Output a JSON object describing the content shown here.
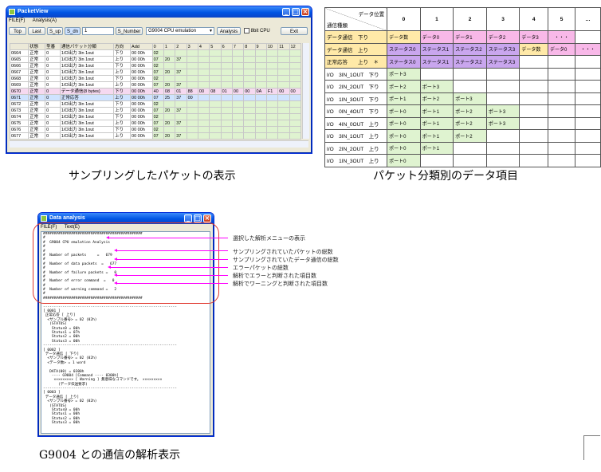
{
  "packetview": {
    "title": "PacketView",
    "menu": [
      "FILE(F)",
      "Analysis(A)"
    ],
    "toolbar": {
      "top": "Top",
      "last": "Last",
      "s_up": "S_up",
      "s_dn": "S_dn",
      "number_value": "1",
      "s_number": "S_Number",
      "emulation": "G9004 CPU emulation",
      "analysis": "Analysis",
      "bit_cpu": "8bit CPU",
      "exit": "Exit"
    },
    "columns": [
      "",
      "状態",
      "型番",
      "通信パケット分類",
      "方向",
      "Add",
      "0",
      "1",
      "2",
      "3",
      "4",
      "5",
      "6",
      "7",
      "8",
      "9",
      "10",
      "11",
      "12"
    ],
    "rows": [
      [
        "0664",
        "正常",
        "0",
        "1/O出力 3in 1out",
        "下り",
        "00 00h",
        "02",
        "",
        "",
        "",
        "",
        "",
        "",
        "",
        "",
        "",
        "",
        "",
        ""
      ],
      [
        "0665",
        "正常",
        "0",
        "1/O出力 3in 1out",
        "上り",
        "00 00h",
        "07",
        "20",
        "37",
        "",
        "",
        "",
        "",
        "",
        "",
        "",
        "",
        "",
        ""
      ],
      [
        "0666",
        "正常",
        "0",
        "1/O出力 3in 1out",
        "下り",
        "00 00h",
        "02",
        "",
        "",
        "",
        "",
        "",
        "",
        "",
        "",
        "",
        "",
        "",
        ""
      ],
      [
        "0667",
        "正常",
        "0",
        "1/O出力 3in 1out",
        "上り",
        "00 00h",
        "07",
        "20",
        "37",
        "",
        "",
        "",
        "",
        "",
        "",
        "",
        "",
        "",
        ""
      ],
      [
        "0668",
        "正常",
        "0",
        "1/O出力 3in 1out",
        "下り",
        "00 00h",
        "02",
        "",
        "",
        "",
        "",
        "",
        "",
        "",
        "",
        "",
        "",
        "",
        ""
      ],
      [
        "0669",
        "正常",
        "0",
        "1/O出力 3in 1out",
        "上り",
        "00 00h",
        "07",
        "20",
        "37",
        "",
        "",
        "",
        "",
        "",
        "",
        "",
        "",
        "",
        ""
      ],
      [
        "0670",
        "正常",
        "0",
        "データ通信(8 bytes)",
        "下り",
        "00 00h",
        "40",
        "08",
        "01",
        "88",
        "00",
        "08",
        "01",
        "00",
        "00",
        "0A",
        "F1",
        "00",
        "00"
      ],
      [
        "0671",
        "正常",
        "0",
        "正常応答",
        "上り",
        "00 00h",
        "07",
        "25",
        "37",
        "00",
        "",
        "",
        "",
        "",
        "",
        "",
        "",
        "",
        ""
      ],
      [
        "0672",
        "正常",
        "0",
        "1/O出力 3in 1out",
        "下り",
        "00 00h",
        "02",
        "",
        "",
        "",
        "",
        "",
        "",
        "",
        "",
        "",
        "",
        "",
        ""
      ],
      [
        "0673",
        "正常",
        "0",
        "1/O出力 3in 1out",
        "上り",
        "00 00h",
        "07",
        "20",
        "37",
        "",
        "",
        "",
        "",
        "",
        "",
        "",
        "",
        "",
        ""
      ],
      [
        "0674",
        "正常",
        "0",
        "1/O出力 3in 1out",
        "下り",
        "00 00h",
        "02",
        "",
        "",
        "",
        "",
        "",
        "",
        "",
        "",
        "",
        "",
        "",
        ""
      ],
      [
        "0675",
        "正常",
        "0",
        "1/O出力 3in 1out",
        "上り",
        "00 00h",
        "07",
        "20",
        "37",
        "",
        "",
        "",
        "",
        "",
        "",
        "",
        "",
        "",
        ""
      ],
      [
        "0676",
        "正常",
        "0",
        "1/O出力 3in 1out",
        "下り",
        "00 00h",
        "02",
        "",
        "",
        "",
        "",
        "",
        "",
        "",
        "",
        "",
        "",
        "",
        ""
      ],
      [
        "0677",
        "正常",
        "0",
        "1/O出力 3in 1out",
        "上り",
        "00 00h",
        "07",
        "20",
        "37",
        "",
        "",
        "",
        "",
        "",
        "",
        "",
        "",
        "",
        ""
      ]
    ]
  },
  "caption_left": "サンプリングしたパケットの表示",
  "caption_right": "パケット分類別のデータ項目",
  "caption_bottom": "G9004 との通信の解析表示",
  "classify": {
    "corner_top": "データ位置",
    "corner_bottom": "通信種類",
    "positions": [
      "0",
      "1",
      "2",
      "3",
      "4",
      "5",
      "…"
    ],
    "rows": [
      {
        "label": "データ通信　下り",
        "cells": [
          "データ数",
          "データ0",
          "データ1",
          "データ2",
          "データ3",
          "・・・",
          ""
        ]
      },
      {
        "label": "データ通信　上り",
        "cells": [
          "ステータス0",
          "ステータス1",
          "ステータス2",
          "ステータス3",
          "データ数",
          "データ0",
          "・・・"
        ]
      },
      {
        "label": "正常応答　　上り　＊",
        "cells": [
          "ステータス0",
          "ステータス1",
          "ステータス2",
          "ステータス3",
          "",
          "",
          ""
        ]
      },
      {
        "label": "I/O　3IN_1OUT　下り",
        "cells": [
          "ポート3",
          "",
          "",
          "",
          "",
          "",
          ""
        ]
      },
      {
        "label": "I/O　2IN_2OUT　下り",
        "cells": [
          "ポート2",
          "ポート3",
          "",
          "",
          "",
          "",
          ""
        ]
      },
      {
        "label": "I/O　1IN_3OUT　下り",
        "cells": [
          "ポート1",
          "ポート2",
          "ポート3",
          "",
          "",
          "",
          ""
        ]
      },
      {
        "label": "I/O　0IN_4OUT　下り",
        "cells": [
          "ポート0",
          "ポート1",
          "ポート2",
          "ポート3",
          "",
          "",
          ""
        ]
      },
      {
        "label": "I/O　4IN_0OUT　上り",
        "cells": [
          "ポート0",
          "ポート1",
          "ポート2",
          "ポート3",
          "",
          "",
          ""
        ]
      },
      {
        "label": "I/O　3IN_1OUT　上り",
        "cells": [
          "ポート0",
          "ポート1",
          "ポート2",
          "",
          "",
          "",
          ""
        ]
      },
      {
        "label": "I/O　2IN_2OUT　上り",
        "cells": [
          "ポート0",
          "ポート1",
          "",
          "",
          "",
          "",
          ""
        ]
      },
      {
        "label": "I/O　1IN_3OUT　上り",
        "cells": [
          "ポート0",
          "",
          "",
          "",
          "",
          "",
          ""
        ]
      }
    ]
  },
  "analysis": {
    "title": "Data analysis",
    "menu": [
      "FILE(F)",
      "Text(E)"
    ],
    "lines": [
      "##############################################",
      "#",
      "#  G9004 CPU emulation Analysis",
      "#",
      "#",
      "#  Number of packets     =   679",
      "#",
      "#  Number of data packets  =   677",
      "#",
      "#  Number of failure packets =   0",
      "#",
      "#  Number of error command  =   0",
      "#",
      "#  Number of warning command =   2",
      "#",
      "##############################################",
      "",
      "--------------------------------------------------------------",
      "[ 0001 ]",
      " 正常応答 [ 上り]",
      "  <サンプル番号> = 02 (02h)",
      "   (STATUS)",
      "    Status0 = 00h",
      "    Status1 = 07h",
      "    Status2 = 00h",
      "    Status3 = 00h",
      "--------------------------------------------------------------",
      "[ 0002 ]",
      " データ通信 [ 下り]",
      "  <サンプル番号> = 02 (02h)",
      "  <データ数> = 1 word",
      "",
      "   DATA(00) = 0300h",
      "    ---- G9004 [Command ---- 0300h]",
      "     ××××××××× [ Warning ] 無意味なコマンドです。 ×××××××××",
      "       (データ伝送要求)",
      "--------------------------------------------------------------",
      "[ 0003 ]",
      " データ通信 [ 上り]",
      "  <サンプル番号> = 02 (02h)",
      "   (STATUS)",
      "    Status0 = 00h",
      "    Status1 = 00h",
      "    Status2 = 00h",
      "    Status3 = 00h"
    ]
  },
  "annotations": [
    "選択した解析メニューの表示",
    "サンプリングされていたパケットの総数",
    "サンプリングされていたデータ通信の総数",
    "エラーパケットの総数",
    "解析でエラーと判断された項目数",
    "解析でワーニングと判断された項目数"
  ],
  "colors": {
    "xp_title": "#0054e3",
    "annotation": "#ff00ff",
    "highlight_box": "#e0362c",
    "pink": "#f8b8e8",
    "purple": "#c9a6ee",
    "yellow": "#ffe9a8",
    "green": "#dff3d0"
  }
}
